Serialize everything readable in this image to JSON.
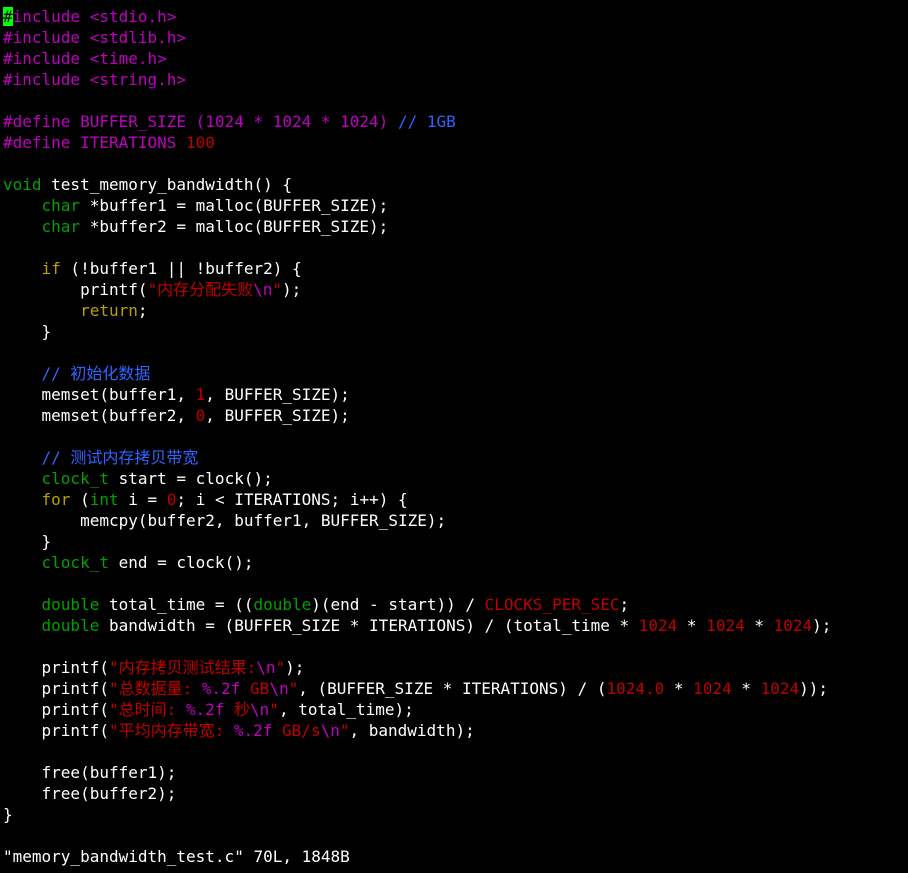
{
  "window": {
    "background": "#000000",
    "title": "memory_bandwidth_test.c"
  },
  "colors": {
    "normal": "#ffffff",
    "preproc": "#c000c0",
    "include_string": "#c000c0",
    "string": "#c00000",
    "number": "#c00000",
    "comment": "#2f64ff",
    "type": "#00a000",
    "keyword": "#b8a000",
    "constant": "#c00000",
    "escape": "#c000c0",
    "cursor_bg": "#00ff00",
    "cursor_fg": "#000000"
  },
  "editor": {
    "cursor": {
      "line": 0,
      "char": "#"
    },
    "lines": [
      [
        [
          "cursor",
          "#"
        ],
        [
          "preproc",
          "include "
        ],
        [
          "include_string",
          "<stdio.h>"
        ]
      ],
      [
        [
          "preproc",
          "#include "
        ],
        [
          "include_string",
          "<stdlib.h>"
        ]
      ],
      [
        [
          "preproc",
          "#include "
        ],
        [
          "include_string",
          "<time.h>"
        ]
      ],
      [
        [
          "preproc",
          "#include "
        ],
        [
          "include_string",
          "<string.h>"
        ]
      ],
      [],
      [
        [
          "preproc",
          "#define BUFFER_SIZE "
        ],
        [
          "preproc",
          "(1024 * 1024 * 1024) "
        ],
        [
          "comment",
          "// 1GB"
        ]
      ],
      [
        [
          "preproc",
          "#define ITERATIONS "
        ],
        [
          "number",
          "100"
        ]
      ],
      [],
      [
        [
          "type",
          "void"
        ],
        [
          "normal",
          " test_memory_bandwidth() {"
        ]
      ],
      [
        [
          "normal",
          "    "
        ],
        [
          "type",
          "char"
        ],
        [
          "normal",
          " *buffer1 = malloc(BUFFER_SIZE);"
        ]
      ],
      [
        [
          "normal",
          "    "
        ],
        [
          "type",
          "char"
        ],
        [
          "normal",
          " *buffer2 = malloc(BUFFER_SIZE);"
        ]
      ],
      [],
      [
        [
          "normal",
          "    "
        ],
        [
          "keyword",
          "if"
        ],
        [
          "normal",
          " (!buffer1 || !buffer2) {"
        ]
      ],
      [
        [
          "normal",
          "        printf("
        ],
        [
          "string",
          "\"内存分配失败"
        ],
        [
          "escape",
          "\\n"
        ],
        [
          "string",
          "\""
        ],
        [
          "normal",
          ");"
        ]
      ],
      [
        [
          "normal",
          "        "
        ],
        [
          "keyword",
          "return"
        ],
        [
          "normal",
          ";"
        ]
      ],
      [
        [
          "normal",
          "    }"
        ]
      ],
      [],
      [
        [
          "normal",
          "    "
        ],
        [
          "comment",
          "// 初始化数据"
        ]
      ],
      [
        [
          "normal",
          "    memset(buffer1, "
        ],
        [
          "number",
          "1"
        ],
        [
          "normal",
          ", BUFFER_SIZE);"
        ]
      ],
      [
        [
          "normal",
          "    memset(buffer2, "
        ],
        [
          "number",
          "0"
        ],
        [
          "normal",
          ", BUFFER_SIZE);"
        ]
      ],
      [],
      [
        [
          "normal",
          "    "
        ],
        [
          "comment",
          "// 测试内存拷贝带宽"
        ]
      ],
      [
        [
          "normal",
          "    "
        ],
        [
          "type",
          "clock_t"
        ],
        [
          "normal",
          " start = clock();"
        ]
      ],
      [
        [
          "normal",
          "    "
        ],
        [
          "keyword",
          "for"
        ],
        [
          "normal",
          " ("
        ],
        [
          "type",
          "int"
        ],
        [
          "normal",
          " i = "
        ],
        [
          "number",
          "0"
        ],
        [
          "normal",
          "; i < ITERATIONS; i++) {"
        ]
      ],
      [
        [
          "normal",
          "        memcpy(buffer2, buffer1, BUFFER_SIZE);"
        ]
      ],
      [
        [
          "normal",
          "    }"
        ]
      ],
      [
        [
          "normal",
          "    "
        ],
        [
          "type",
          "clock_t"
        ],
        [
          "normal",
          " end = clock();"
        ]
      ],
      [],
      [
        [
          "normal",
          "    "
        ],
        [
          "type",
          "double"
        ],
        [
          "normal",
          " total_time = (("
        ],
        [
          "type",
          "double"
        ],
        [
          "normal",
          ")(end - start)) / "
        ],
        [
          "constant",
          "CLOCKS_PER_SEC"
        ],
        [
          "normal",
          ";"
        ]
      ],
      [
        [
          "normal",
          "    "
        ],
        [
          "type",
          "double"
        ],
        [
          "normal",
          " bandwidth = (BUFFER_SIZE * ITERATIONS) / (total_time * "
        ],
        [
          "number",
          "1024"
        ],
        [
          "normal",
          " * "
        ],
        [
          "number",
          "1024"
        ],
        [
          "normal",
          " * "
        ],
        [
          "number",
          "1024"
        ],
        [
          "normal",
          ");"
        ]
      ],
      [],
      [
        [
          "normal",
          "    printf("
        ],
        [
          "string",
          "\"内存拷贝测试结果:"
        ],
        [
          "escape",
          "\\n"
        ],
        [
          "string",
          "\""
        ],
        [
          "normal",
          ");"
        ]
      ],
      [
        [
          "normal",
          "    printf("
        ],
        [
          "string",
          "\"总数据量: "
        ],
        [
          "escape",
          "%.2f"
        ],
        [
          "string",
          " GB"
        ],
        [
          "escape",
          "\\n"
        ],
        [
          "string",
          "\""
        ],
        [
          "normal",
          ", (BUFFER_SIZE * ITERATIONS) / ("
        ],
        [
          "number",
          "1024.0"
        ],
        [
          "normal",
          " * "
        ],
        [
          "number",
          "1024"
        ],
        [
          "normal",
          " * "
        ],
        [
          "number",
          "1024"
        ],
        [
          "normal",
          "));"
        ]
      ],
      [
        [
          "normal",
          "    printf("
        ],
        [
          "string",
          "\"总时间: "
        ],
        [
          "escape",
          "%.2f"
        ],
        [
          "string",
          " 秒"
        ],
        [
          "escape",
          "\\n"
        ],
        [
          "string",
          "\""
        ],
        [
          "normal",
          ", total_time);"
        ]
      ],
      [
        [
          "normal",
          "    printf("
        ],
        [
          "string",
          "\"平均内存带宽: "
        ],
        [
          "escape",
          "%.2f"
        ],
        [
          "string",
          " GB/s"
        ],
        [
          "escape",
          "\\n"
        ],
        [
          "string",
          "\""
        ],
        [
          "normal",
          ", bandwidth);"
        ]
      ],
      [],
      [
        [
          "normal",
          "    free(buffer1);"
        ]
      ],
      [
        [
          "normal",
          "    free(buffer2);"
        ]
      ],
      [
        [
          "normal",
          "}"
        ]
      ]
    ]
  },
  "statusbar": {
    "text": "\"memory_bandwidth_test.c\" 70L, 1848B"
  }
}
